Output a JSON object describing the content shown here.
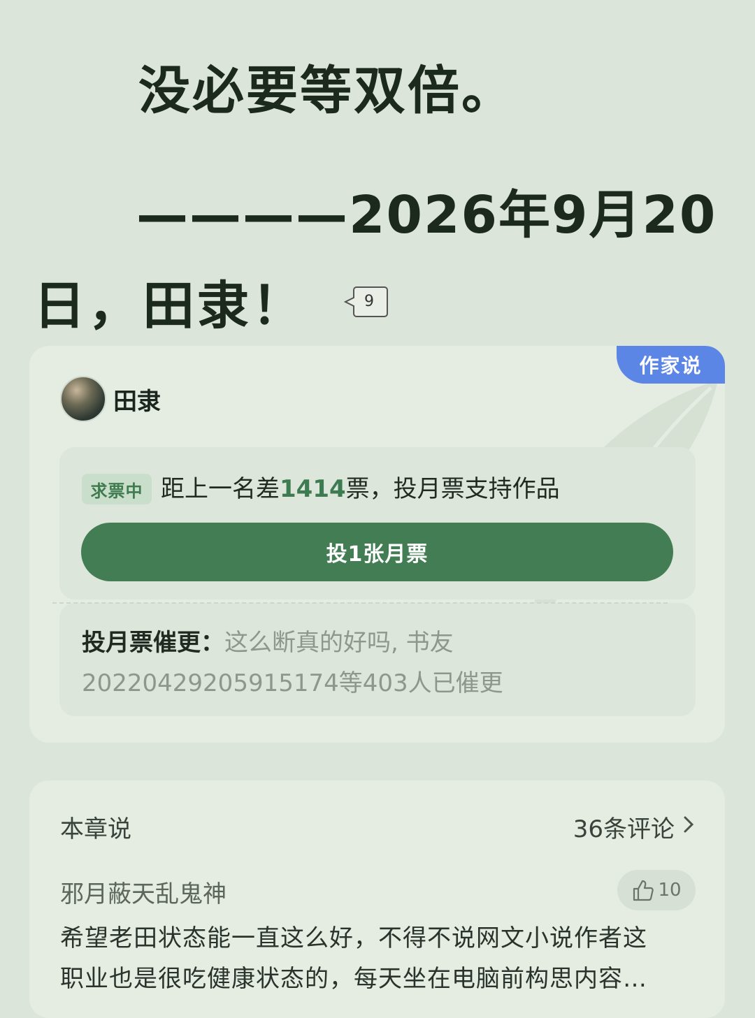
{
  "chapter": {
    "line1": "没必要等双倍。",
    "line2": "————2026年9月20",
    "line3": "日，田隶！",
    "paragraph_comment_count": "9"
  },
  "author_card": {
    "tag": "作家说",
    "author_name": "田隶",
    "status_badge": "求票中",
    "vote_prefix": "距上一名差",
    "vote_gap": "1414",
    "vote_suffix": "票，投月票支持作品",
    "vote_button": "投1张月票",
    "urge_label": "投月票催更：",
    "urge_text": "这么断真的好吗, 书友20220429205915174等403人已催更"
  },
  "chapter_comments": {
    "title": "本章说",
    "count_label": "36条评论",
    "comment": {
      "user": "邪月蔽天乱鬼神",
      "likes": "10",
      "line1": "希望老田状态能一直这么好，不得不说网文小说作者这",
      "line2": "职业也是很吃健康状态的，每天坐在电脑前构思内容…"
    }
  },
  "colors": {
    "background": "#dbe5d9",
    "accent_green": "#427d54",
    "author_tag_blue": "#5b86e6"
  }
}
